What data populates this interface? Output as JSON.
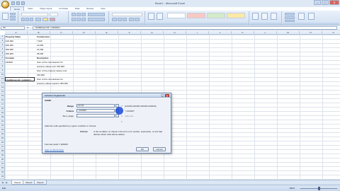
{
  "window": {
    "title": "Book1 - Microsoft Excel",
    "controls": {
      "minimize": "–",
      "maximize": "□",
      "close": "✕"
    }
  },
  "ribbon": {
    "tabs": [
      "Home",
      "Insert",
      "Page Layout",
      "Formulas",
      "Data",
      "Review",
      "View"
    ],
    "active_tab": "Home"
  },
  "formula_bar": {
    "name_box": "C6",
    "fx_label": "fx",
    "formula": "=SUMIF(A2:A5,\">160000\")"
  },
  "sheet": {
    "columns": [
      "A",
      "B",
      "C",
      "D",
      "E",
      "F",
      "G",
      "H",
      "I",
      "J",
      "K",
      "L",
      "M",
      "N",
      "O"
    ],
    "rows": [
      "1",
      "2",
      "3",
      "4",
      "5",
      "6",
      "7",
      "8",
      "9",
      "10",
      "11",
      "12",
      "13",
      "14",
      "15",
      "16",
      "17",
      "18",
      "19",
      "20",
      "21",
      "22",
      "23",
      "24",
      "25",
      "26",
      "27",
      "28",
      "29",
      "30",
      "31",
      "32",
      "33",
      "34"
    ],
    "header_a": "Property Value",
    "header_b": "Commission",
    "values_a": [
      "100,000",
      "200,000",
      "300,000",
      "400,000"
    ],
    "values_b": [
      "7,000",
      "14,000",
      "21,000",
      "28,000"
    ],
    "formula_header": "Formula",
    "description_header": "Description",
    "formula_cell": "=SUMIF(A2:A5,\">160000\")",
    "formula_row_value": "160000",
    "desc_lines": [
      "Sum of the commissions for",
      "property values over 160,000.",
      "Sum of the property values over",
      "160,000.",
      "Sum of the commissions for",
      "property values equal to 300,000."
    ]
  },
  "sheet_tabs": [
    "Sheet1",
    "Sheet2",
    "Sheet3"
  ],
  "active_sheet": "Sheet1",
  "status": {
    "mode": "Edit",
    "zoom": "100%",
    "zoom_fraction": 0.5
  },
  "dialog": {
    "title": "Function Arguments",
    "function_name": "SUMIF",
    "args": [
      {
        "label": "Range",
        "value": "A2:A5",
        "result": "{100000;200000;300000;400000}"
      },
      {
        "label": "Criteria",
        "value": ">160000",
        "result": "\">160000\""
      },
      {
        "label": "Sum_range",
        "value": "",
        "result": "reference"
      }
    ],
    "equals": "=",
    "formula_equals": "=",
    "description": "Adds the cells specified by a given condition or criteria.",
    "arg_desc_name": "Criteria",
    "arg_desc": "is the condition or criteria in the form of a number, expression, or text that defines which cells will be added.",
    "formula_result": "Formula result =   900000",
    "help_link": "Help on this function",
    "ok": "OK",
    "cancel": "Cancel",
    "help_btn": "?",
    "close_btn": "✕"
  }
}
